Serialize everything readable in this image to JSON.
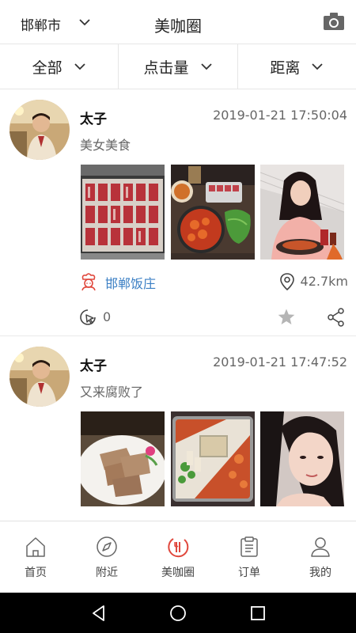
{
  "header": {
    "city": "邯郸市",
    "title": "美咖圈",
    "icons": {
      "dropdown": "chevron-down-icon",
      "camera": "camera-icon"
    }
  },
  "filters": [
    {
      "label": "全部"
    },
    {
      "label": "点击量"
    },
    {
      "label": "距离"
    }
  ],
  "posts": [
    {
      "username": "太子",
      "time": "2019-01-21 17:50:04",
      "caption": "美女美食",
      "shop": "邯郸饭庄",
      "distance": "42.7km",
      "clicks": "0",
      "photos": [
        "raw-meat-tray-photo",
        "korean-bbq-table-photo",
        "girl-eating-photo"
      ]
    },
    {
      "username": "太子",
      "time": "2019-01-21 17:47:52",
      "caption": "又来腐败了",
      "photos": [
        "sliced-meat-plate-photo",
        "hot-pot-photo",
        "girl-selfie-photo"
      ]
    }
  ],
  "tabbar": [
    {
      "label": "首页",
      "icon": "home-icon"
    },
    {
      "label": "附近",
      "icon": "compass-icon"
    },
    {
      "label": "美咖圈",
      "icon": "meika-circle-icon"
    },
    {
      "label": "订单",
      "icon": "clipboard-icon"
    },
    {
      "label": "我的",
      "icon": "person-icon"
    }
  ],
  "colors": {
    "link": "#3b7fc4",
    "brand_red": "#e0473c",
    "nav_bg": "#000000"
  }
}
